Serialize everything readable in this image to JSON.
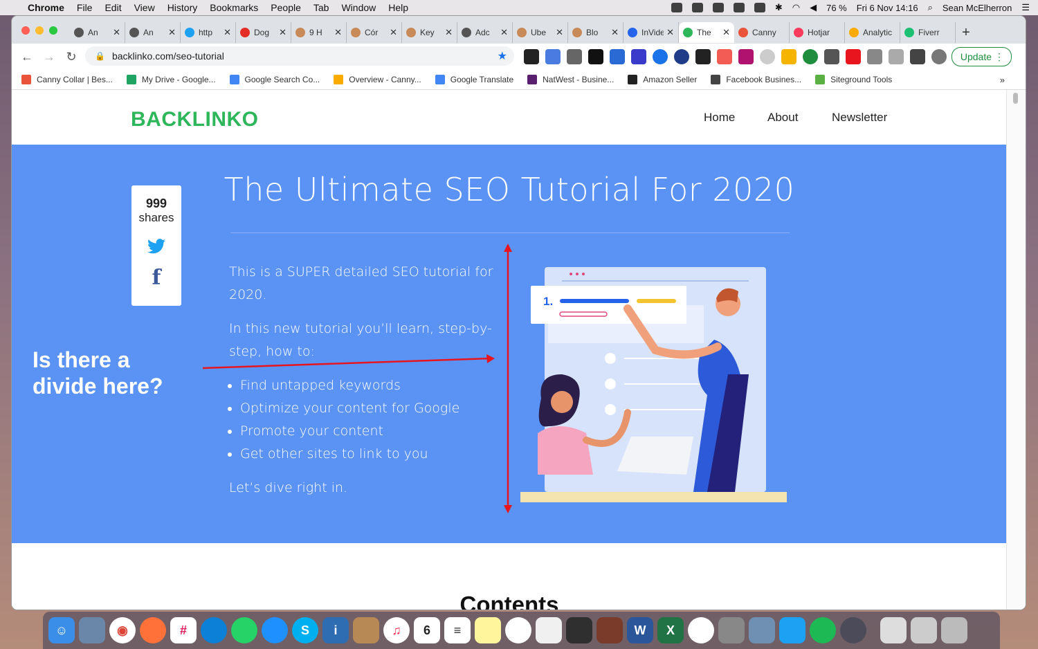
{
  "menubar": {
    "app": "Chrome",
    "items": [
      "File",
      "Edit",
      "View",
      "History",
      "Bookmarks",
      "People",
      "Tab",
      "Window",
      "Help"
    ],
    "battery": "76 %",
    "datetime": "Fri 6 Nov  14:16",
    "user": "Sean McElherron"
  },
  "tabs": [
    {
      "label": "An",
      "color": "#555"
    },
    {
      "label": "An",
      "color": "#555"
    },
    {
      "label": "http",
      "color": "#1da1f2"
    },
    {
      "label": "Dog",
      "color": "#e52d27"
    },
    {
      "label": "9 H",
      "color": "#c98a5a"
    },
    {
      "label": "Cór",
      "color": "#c98a5a"
    },
    {
      "label": "Key",
      "color": "#c98a5a"
    },
    {
      "label": "Adc",
      "color": "#555"
    },
    {
      "label": "Ube",
      "color": "#c98a5a"
    },
    {
      "label": "Blo",
      "color": "#c98a5a"
    },
    {
      "label": "InVideo",
      "color": "#2563eb"
    },
    {
      "label": "The",
      "color": "#2db65a",
      "active": true
    },
    {
      "label": "Canny",
      "color": "#e8533a"
    },
    {
      "label": "Hotjar",
      "color": "#fd3a5c"
    },
    {
      "label": "Analytic",
      "color": "#f9ab00"
    },
    {
      "label": "Fiverr",
      "color": "#1dbf73"
    }
  ],
  "toolbar": {
    "url": "backlinko.com/seo-tutorial",
    "update_label": "Update"
  },
  "bookmarks": [
    {
      "label": "Canny Collar | Bes...",
      "color": "#e8533a"
    },
    {
      "label": "My Drive - Google...",
      "color": "#1fa463"
    },
    {
      "label": "Google Search Co...",
      "color": "#4285f4"
    },
    {
      "label": "Overview - Canny...",
      "color": "#f9ab00"
    },
    {
      "label": "Google Translate",
      "color": "#4285f4"
    },
    {
      "label": "NatWest - Busine...",
      "color": "#5a1f6e"
    },
    {
      "label": "Amazon Seller",
      "color": "#222"
    },
    {
      "label": "Facebook Busines...",
      "color": "#444"
    },
    {
      "label": "Siteground Tools",
      "color": "#5ab043"
    }
  ],
  "site": {
    "logo": "BACKLINKO",
    "nav": [
      "Home",
      "About",
      "Newsletter"
    ],
    "title": "The Ultimate SEO Tutorial For 2020",
    "shares_count": "999",
    "shares_label": "shares",
    "intro_p1": "This is a SUPER detailed SEO tutorial for 2020.",
    "intro_p2": "In this new tutorial you’ll learn, step-by-step, how to:",
    "bullets": [
      "Find untapped keywords",
      "Optimize your content for Google",
      "Promote your content",
      "Get other sites to link to you"
    ],
    "outro": "Let’s dive right in.",
    "question": "Is there a divide here?",
    "contents_heading": "Contents",
    "illus_number": "1."
  },
  "colors": {
    "hero": "#5b93f4",
    "brand_green": "#2db65a",
    "annotation_red": "#e8141e"
  }
}
